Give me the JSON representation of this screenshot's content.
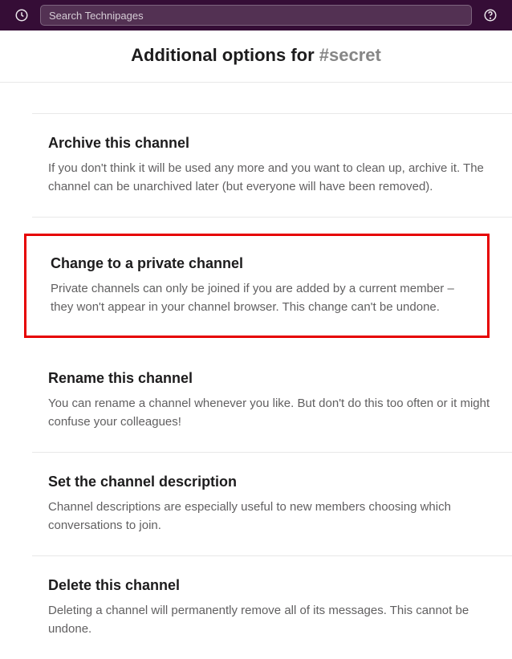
{
  "topbar": {
    "search_placeholder": "Search Technipages"
  },
  "header": {
    "title_prefix": "Additional options for ",
    "channel": "#secret"
  },
  "options": {
    "archive": {
      "title": "Archive this channel",
      "desc": "If you don't think it will be used any more and you want to clean up, archive it. The channel can be unarchived later (but everyone will have been removed)."
    },
    "private": {
      "title": "Change to a private channel",
      "desc": "Private channels can only be joined if you are added by a current member – they won't appear in your channel browser. This change can't be undone."
    },
    "rename": {
      "title": "Rename this channel",
      "desc": "You can rename a channel whenever you like. But don't do this too often or it might confuse your colleagues!"
    },
    "description": {
      "title": "Set the channel description",
      "desc": "Channel descriptions are especially useful to new members choosing which conversations to join."
    },
    "delete": {
      "title": "Delete this channel",
      "desc": "Deleting a channel will permanently remove all of its messages. This cannot be undone."
    }
  }
}
